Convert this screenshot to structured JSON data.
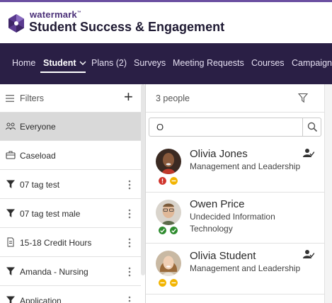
{
  "brand": {
    "small": "watermark",
    "tm": "™",
    "title": "Student Success & Engagement",
    "accent_color": "#4a2f78"
  },
  "nav": {
    "items": [
      {
        "label": "Home"
      },
      {
        "label": "Student",
        "active": true,
        "has_dropdown": true
      },
      {
        "label": "Plans (2)"
      },
      {
        "label": "Surveys"
      },
      {
        "label": "Meeting Requests"
      },
      {
        "label": "Courses"
      },
      {
        "label": "Campaigns"
      }
    ],
    "background": "#2a1f45"
  },
  "sidebar": {
    "header_label": "Filters",
    "add_label": "+",
    "items": [
      {
        "label": "Everyone",
        "icon": "people-icon",
        "selected": true
      },
      {
        "label": "Caseload",
        "icon": "briefcase-icon"
      },
      {
        "label": "07 tag test",
        "icon": "filter-icon",
        "menu": true
      },
      {
        "label": "07 tag test male",
        "icon": "filter-icon",
        "menu": true
      },
      {
        "label": "15-18 Credit Hours",
        "icon": "document-icon",
        "menu": true
      },
      {
        "label": "Amanda - Nursing",
        "icon": "filter-icon",
        "menu": true
      },
      {
        "label": "Application",
        "icon": "filter-icon",
        "menu": true
      }
    ]
  },
  "main": {
    "count_label": "3 people",
    "search": {
      "value": "O",
      "placeholder": "Search"
    },
    "people": [
      {
        "name": "Olivia Jones",
        "program": "Management and Leadership",
        "badges": [
          "error",
          "warning"
        ],
        "assigned": true
      },
      {
        "name": "Owen Price",
        "program": "Undecided Information Technology",
        "badges": [
          "success",
          "success"
        ],
        "assigned": false
      },
      {
        "name": "Olivia Student",
        "program": "Management and Leadership",
        "badges": [
          "warning",
          "warning"
        ],
        "assigned": true
      }
    ]
  },
  "colors": {
    "error": "#d0342c",
    "warning": "#f2b400",
    "success": "#2e8b2e"
  }
}
